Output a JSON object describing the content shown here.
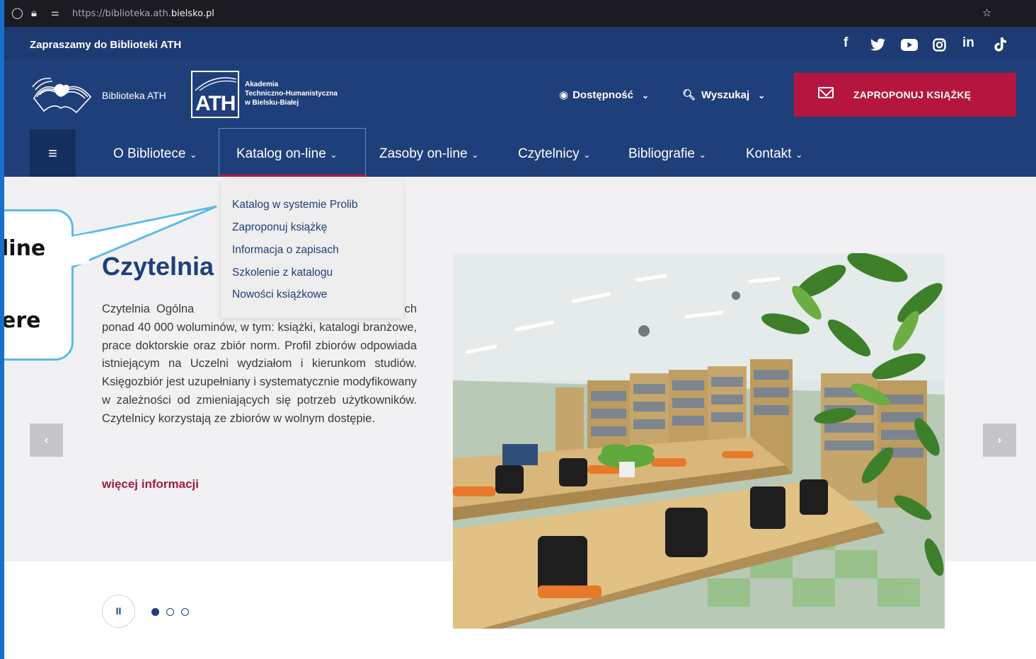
{
  "browser": {
    "url_prefix": "https://biblioteka.ath.",
    "url_domain": "bielsko.pl",
    "shield_icon": "shield-icon",
    "lock_icon": "lock-icon",
    "star_icon": "star-icon"
  },
  "topbar": {
    "welcome": "Zapraszamy do Biblioteki ATH",
    "social": [
      "f",
      "facebook-icon",
      "twitter-icon",
      "youtube-icon",
      "instagram-icon",
      "in",
      "tiktok-icon"
    ]
  },
  "header": {
    "brand": "Biblioteka ATH",
    "ath_logo": "ATH",
    "ath_line1": "Akademia",
    "ath_line2": "Techniczno-Humanistyczna",
    "ath_line3": "w Bielsku-Białej",
    "accessibility": "Dostępność",
    "search": "Wyszukaj",
    "propose_book": "ZAPROPONUJ KSIĄŻKĘ"
  },
  "nav": {
    "items": [
      "O Bibliotece",
      "Katalog on-line",
      "Zasoby on-line",
      "Czytelnicy",
      "Bibliografie",
      "Kontakt"
    ]
  },
  "dropdown": {
    "items": [
      "Katalog w systemie Prolib",
      "Zaproponuj książkę",
      "Informacja o zapisach",
      "Szkolenie z katalogu",
      "Nowości książkowe"
    ]
  },
  "slide": {
    "title": "Czytelnia",
    "description": "Czytelnia Ogólna ... ch ponad 40 000 woluminów, w tym: książki, katalogi branżowe, prace doktorskie oraz zbiór norm. Profil zbiorów odpowiada istniejącym na Uczelni wydziałom i kierunkom studiów. Księgozbiór jest uzupełniany i systematycznie modyfikowany w zależności od zmieniających się potrzeb użytkowników. Czytelnicy korzystają ze zbiorów w wolnym dostępie.",
    "desc_first": "Czytelnia  Ogólna",
    "desc_frag": "ch",
    "desc_rest": "ponad 40 000 woluminów, w tym: książki, katalogi branżowe, prace doktorskie oraz zbiór norm. Profil zbiorów odpowiada istniejącym na Uczelni wydziałom i kierunkom studiów. Księgozbiór jest uzupełniany i systematycznie modyfikowany w zależności od zmieniających się potrzeb użytkowników. Czytelnicy korzystają ze zbiorów w wolnym dostępie.",
    "more": "więcej informacji",
    "prev": "‹",
    "next": "›",
    "pause": "II",
    "active_slide": 1,
    "slide_count": 3
  },
  "callout": {
    "line1": "line",
    "line2": "ere"
  },
  "colors": {
    "navy": "#1f3f7a",
    "crimson": "#b5163f",
    "callout_border": "#5dbbe8"
  }
}
